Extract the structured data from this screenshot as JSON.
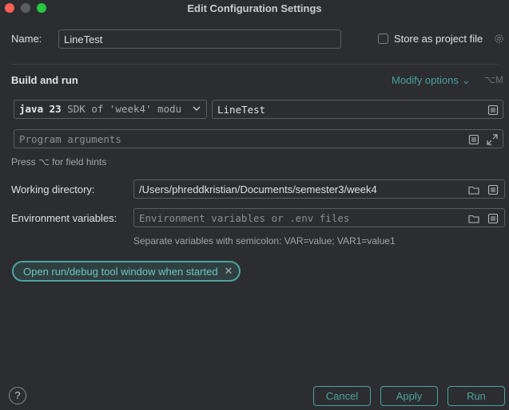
{
  "window": {
    "title": "Edit Configuration Settings"
  },
  "name": {
    "label": "Name:",
    "value": "LineTest"
  },
  "store": {
    "label": "Store as project file"
  },
  "build": {
    "section_title": "Build and run",
    "modify_label": "Modify options",
    "modify_shortcut": "⌥M",
    "sdk_version": "java 23",
    "sdk_desc": "SDK of 'week4' modu",
    "main_class": "LineTest",
    "program_args_placeholder": "Program arguments",
    "field_hint": "Press ⌥ for field hints"
  },
  "workdir": {
    "label": "Working directory:",
    "value": "/Users/phreddkristian/Documents/semester3/week4"
  },
  "env": {
    "label": "Environment variables:",
    "placeholder": "Environment variables or .env files",
    "hint": "Separate variables with semicolon: VAR=value; VAR1=value1"
  },
  "chip": {
    "label": "Open run/debug tool window when started"
  },
  "buttons": {
    "help": "?",
    "cancel": "Cancel",
    "apply": "Apply",
    "run": "Run"
  },
  "colors": {
    "accent": "#4fa3a0",
    "background": "#2b2d30"
  }
}
